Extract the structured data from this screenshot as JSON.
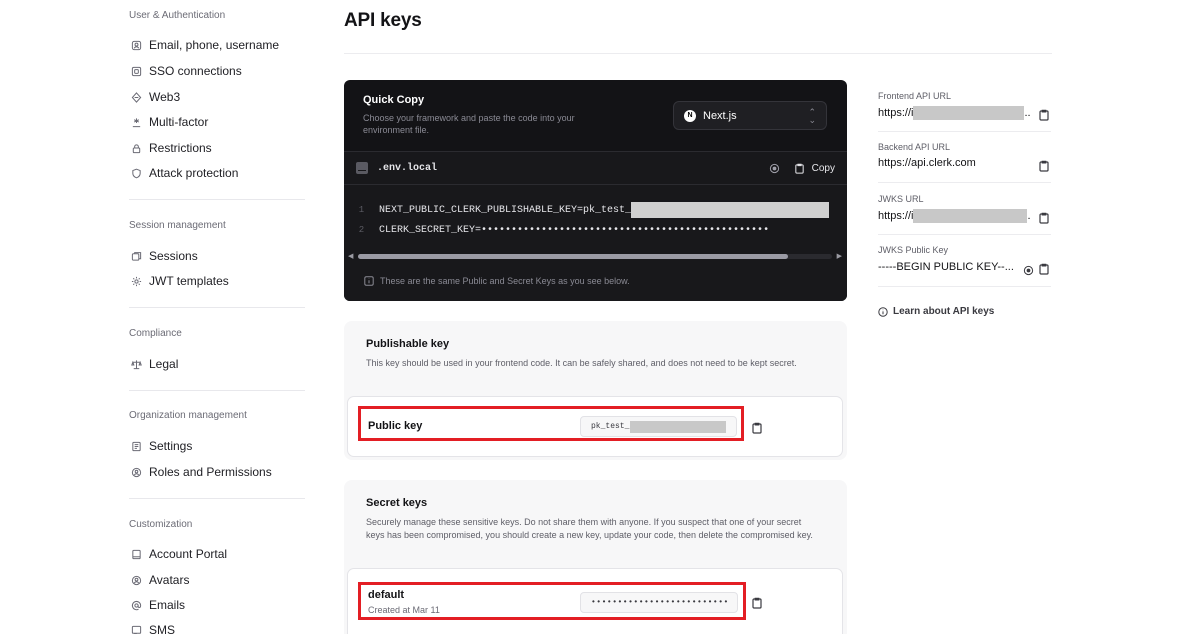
{
  "sidebar": {
    "sections": [
      {
        "title": "User & Authentication",
        "items": [
          {
            "label": "Email, phone, username",
            "icon": "contact-icon"
          },
          {
            "label": "SSO connections",
            "icon": "sso-icon"
          },
          {
            "label": "Web3",
            "icon": "web3-icon"
          },
          {
            "label": "Multi-factor",
            "icon": "multi-factor-icon"
          },
          {
            "label": "Restrictions",
            "icon": "lock-icon"
          },
          {
            "label": "Attack protection",
            "icon": "shield-icon"
          }
        ]
      },
      {
        "title": "Session management",
        "items": [
          {
            "label": "Sessions",
            "icon": "sessions-icon"
          },
          {
            "label": "JWT templates",
            "icon": "gear-icon"
          }
        ]
      },
      {
        "title": "Compliance",
        "items": [
          {
            "label": "Legal",
            "icon": "scales-icon"
          }
        ]
      },
      {
        "title": "Organization management",
        "items": [
          {
            "label": "Settings",
            "icon": "settings-icon"
          },
          {
            "label": "Roles and Permissions",
            "icon": "roles-icon"
          }
        ]
      },
      {
        "title": "Customization",
        "items": [
          {
            "label": "Account Portal",
            "icon": "portal-icon"
          },
          {
            "label": "Avatars",
            "icon": "avatar-icon"
          },
          {
            "label": "Emails",
            "icon": "at-icon"
          },
          {
            "label": "SMS",
            "icon": "sms-icon"
          }
        ]
      }
    ]
  },
  "page": {
    "title": "API keys"
  },
  "quick_copy": {
    "title": "Quick Copy",
    "description": "Choose your framework and paste the code into your environment file.",
    "framework": "Next.js",
    "framework_logo": "N",
    "file_name": ".env.local",
    "copy_label": "Copy",
    "lines": [
      {
        "num": "1",
        "text": "NEXT_PUBLIC_CLERK_PUBLISHABLE_KEY=pk_test_"
      },
      {
        "num": "2",
        "text": "CLERK_SECRET_KEY=••••••••••••••••••••••••••••••••••••••••••••••••"
      }
    ],
    "note": "These are the same Public and Secret Keys as you see below."
  },
  "publishable": {
    "title": "Publishable key",
    "description": "This key should be used in your frontend code. It can be safely shared, and does not need to be kept secret.",
    "key_label": "Public key",
    "key_prefix": "pk_test_"
  },
  "secret": {
    "title": "Secret keys",
    "description": "Securely manage these sensitive keys. Do not share them with anyone. If you suspect that one of your secret keys has been compromised, you should create a new key, update your code, then delete the compromised key.",
    "key_name": "default",
    "key_created": "Created at Mar 11",
    "key_masked": "••••••••••••••••••••••••••"
  },
  "right": {
    "frontend_label": "Frontend API URL",
    "frontend_value": "https://i",
    "frontend_suffix": "..",
    "backend_label": "Backend API URL",
    "backend_value": "https://api.clerk.com",
    "jwks_label": "JWKS URL",
    "jwks_value": "https://i",
    "jwks_suffix": ".",
    "jwks_pk_label": "JWKS Public Key",
    "jwks_pk_value": "-----BEGIN PUBLIC KEY--...",
    "learn_label": "Learn about API keys"
  },
  "colors": {
    "highlight": "#e31e24",
    "dark_card": "#131316"
  }
}
